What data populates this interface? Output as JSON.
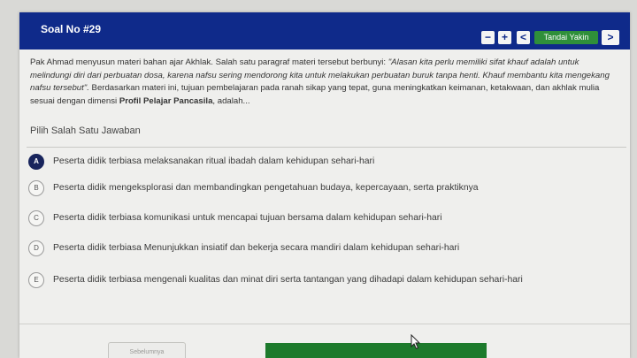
{
  "header": {
    "title": "Soal No #29",
    "minus_label": "−",
    "plus_label": "+",
    "prev_label": "<",
    "flag_label": "Tandai Yakin",
    "next_label": ">"
  },
  "question": {
    "intro": "Pak Ahmad menyusun materi bahan ajar Akhlak. Salah satu paragraf materi tersebut berbunyi: ",
    "quote_a": "\"Alasan kita perlu memiliki sifat",
    "quote_b": " khauf adalah untuk melindungi diri dari perbuatan dosa, karena nafsu sering mendorong kita untuk melakukan perbuatan buruk",
    "quote_c": " tanpa henti. Khauf membantu kita mengekang nafsu tersebut\".",
    "rest": " Berdasarkan materi ini, tujuan pembelajaran pada ranah sikap yang tepat, guna meningkatkan keimanan, ketakwaan, dan akhlak mulia sesuai dengan dimensi ",
    "bold_term": "Profil Pelajar Pancasila",
    "ending": ", adalah..."
  },
  "prompt": "Pilih Salah Satu Jawaban",
  "options": [
    {
      "letter": "A",
      "text": "Peserta didik terbiasa melaksanakan ritual ibadah dalam kehidupan sehari-hari"
    },
    {
      "letter": "B",
      "text": "Peserta didik mengeksplorasi dan membandingkan pengetahuan budaya, kepercayaan, serta praktiknya"
    },
    {
      "letter": "C",
      "text": "Peserta didik terbiasa komunikasi untuk mencapai tujuan bersama dalam kehidupan sehari-hari"
    },
    {
      "letter": "D",
      "text": "Peserta didik terbiasa Menunjukkan insiatif dan bekerja secara mandiri dalam kehidupan sehari-hari"
    },
    {
      "letter": "E",
      "text": "Peserta didik terbiasa mengenali kualitas dan minat diri serta tantangan yang dihadapi dalam kehidupan sehari-hari"
    }
  ],
  "selected_option": "A",
  "footer": {
    "button_label": "Sebelumnya"
  },
  "colors": {
    "header_bg": "#0f2a8a",
    "flag_bg": "#2f8f3a",
    "selected_badge": "#18245c"
  }
}
